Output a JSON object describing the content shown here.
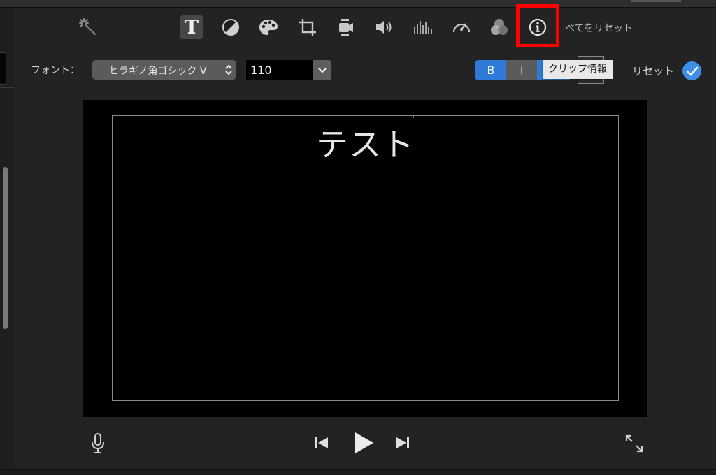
{
  "toolbar": {
    "items": [
      {
        "name": "enhance",
        "icon": "magic-wand-icon"
      },
      {
        "name": "title",
        "icon": "title-t-icon",
        "glyph": "T",
        "selected": true
      },
      {
        "name": "color-balance",
        "icon": "color-balance-icon"
      },
      {
        "name": "color-correction",
        "icon": "palette-icon"
      },
      {
        "name": "crop",
        "icon": "crop-icon"
      },
      {
        "name": "stabilization",
        "icon": "camera-stabilize-icon"
      },
      {
        "name": "volume",
        "icon": "speaker-icon"
      },
      {
        "name": "noise-reduction",
        "icon": "equalizer-icon"
      },
      {
        "name": "speed",
        "icon": "speedometer-icon"
      },
      {
        "name": "clip-filter",
        "icon": "filter-circles-icon"
      },
      {
        "name": "clip-info",
        "icon": "info-circle-icon",
        "highlighted": true
      }
    ],
    "reset_all": "べてをリセット",
    "highlight_color": "#ff0000"
  },
  "font_row": {
    "label": "フォント：",
    "font_value": "ヒラギノ角ゴシック V",
    "size_value": "110",
    "bold": "B",
    "italic": "I",
    "tooltip": "クリップ情報",
    "reset": "リセット"
  },
  "viewer": {
    "title_text": "テスト"
  },
  "transport": {
    "mic": "microphone-icon",
    "prev": "skip-back-icon",
    "play": "play-icon",
    "next": "skip-forward-icon",
    "fullscreen": "fullscreen-icon"
  },
  "colors": {
    "accent": "#2f7ad6",
    "checkmark": "#3d8ee6",
    "background": "#232323"
  }
}
